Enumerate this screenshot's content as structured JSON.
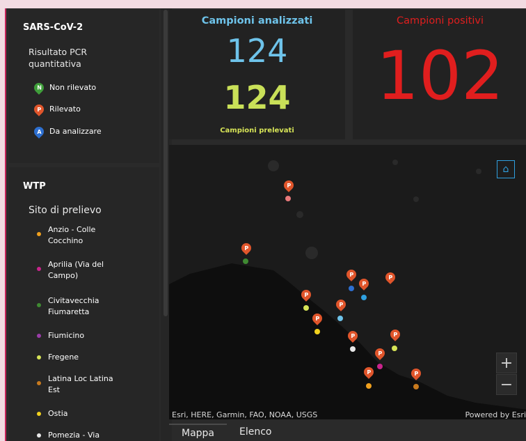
{
  "legend": {
    "sars_title": "SARS-CoV-2",
    "sars_subtitle": "Risultato PCR quantitativa",
    "sars_items": [
      {
        "letter": "N",
        "label": "Non rilevato",
        "color": "#3f9e3a"
      },
      {
        "letter": "P",
        "label": "Rilevato",
        "color": "#e0552b"
      },
      {
        "letter": "A",
        "label": "Da analizzare",
        "color": "#2d6fd0"
      }
    ],
    "wtp_title": "WTP",
    "wtp_subtitle": "Sito di prelievo",
    "wtp_items": [
      {
        "label": "Anzio - Colle Cocchino",
        "color": "#f0a01e"
      },
      {
        "label": "Aprilia (Via del Campo)",
        "color": "#c8248c"
      },
      {
        "label": "Civitavecchia Fiumaretta",
        "color": "#3f8a32"
      },
      {
        "label": "Fiumicino",
        "color": "#9a3ca8"
      },
      {
        "label": "Fregene",
        "color": "#d7e457"
      },
      {
        "label": "Latina Loc Latina Est",
        "color": "#c87a1e"
      },
      {
        "label": "Ostia",
        "color": "#f2d21e"
      },
      {
        "label": "Pomezia - Via",
        "color": "#e8e8e8"
      }
    ]
  },
  "stats": {
    "analyzed_title": "Campioni analizzati",
    "analyzed_value": "124",
    "collected_value": "124",
    "collected_caption": "Campioni prelevati",
    "positive_title": "Campioni positivi",
    "positive_value": "102",
    "analyzed_title_color": "#6ec3ea",
    "positive_title_color": "#e01e1e"
  },
  "map": {
    "attribution": "Esri, HERE, Garmin, FAO, NOAA, USGS",
    "powered_by": "Powered by Esri",
    "zoom_in": "+",
    "zoom_out": "−",
    "pin_letter": "P"
  },
  "tabs": [
    "Mappa",
    "Elenco"
  ]
}
